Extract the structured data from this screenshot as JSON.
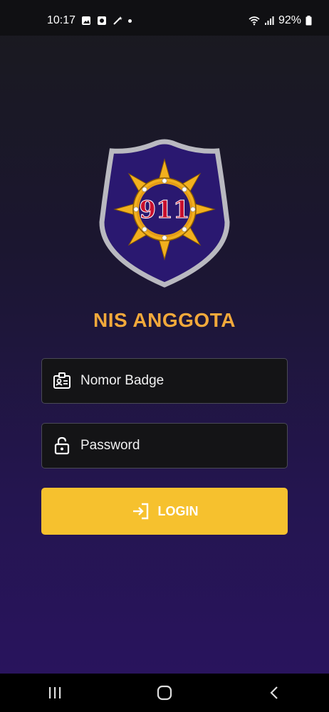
{
  "status_bar": {
    "time": "10:17",
    "battery": "92%",
    "left_icons": [
      "image-icon",
      "notification-icon",
      "magic-wand-icon"
    ],
    "right_icons": [
      "wifi-icon",
      "signal-icon",
      "battery-icon"
    ]
  },
  "logo": {
    "icon": "shield-badge-icon",
    "text": "911",
    "colors": {
      "shield_fill": "#2a1870",
      "shield_border": "#b9b9c0",
      "star": "#f2b01e",
      "emblem_text": "#c8102e"
    }
  },
  "app": {
    "title": "NIS ANGGOTA",
    "title_color": "#f2a93b"
  },
  "form": {
    "badge": {
      "placeholder": "Nomor Badge",
      "value": "",
      "icon": "id-badge-icon"
    },
    "password": {
      "placeholder": "Password",
      "value": "",
      "icon": "lock-icon"
    },
    "login": {
      "label": "LOGIN",
      "icon": "login-icon",
      "color": "#f6c12e"
    }
  },
  "nav_bar": {
    "buttons": [
      "recents-icon",
      "home-icon",
      "back-icon"
    ]
  }
}
